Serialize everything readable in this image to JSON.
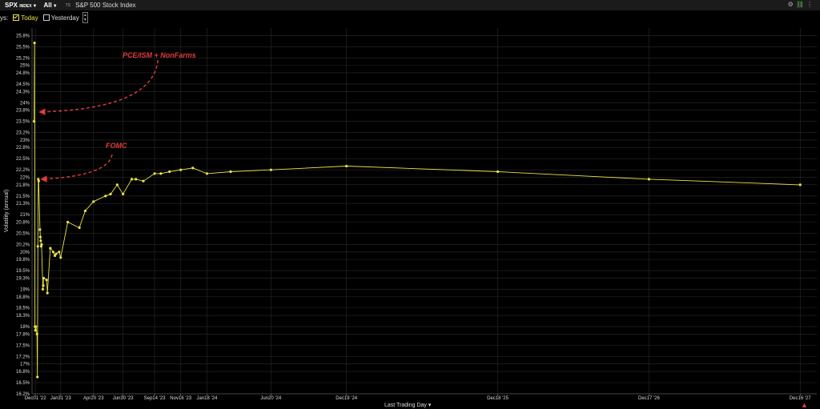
{
  "header": {
    "symbol": "SPX",
    "symbol_suffix": "INDEX",
    "range_selector": "All",
    "ts_label": "TS",
    "instrument_name": "S&P 500 Stock Index"
  },
  "days": {
    "prefix": "ys:",
    "today_label": "Today",
    "today_checked": true,
    "yesterday_label": "Yesterday",
    "yesterday_checked": false
  },
  "x_axis_menu": "Last Trading Day",
  "colors": {
    "series": "#e9e34a",
    "annotation": "#e23b3b",
    "grid": "#2a2a2a",
    "background": "#000000"
  },
  "chart_data": {
    "type": "line",
    "ylabel": "Volatility (annual)",
    "xlabel": "Last Trading Day",
    "x_scale": "time",
    "xlim": [
      "2022-11-23",
      "2028-01-25"
    ],
    "ylim": [
      16.2,
      26.0
    ],
    "y_ticks": [
      16.2,
      16.5,
      16.8,
      17,
      17.2,
      17.5,
      17.8,
      18,
      18.3,
      18.5,
      18.8,
      19,
      19.3,
      19.5,
      19.8,
      20,
      20.2,
      20.5,
      20.8,
      21,
      21.3,
      21.5,
      21.8,
      22,
      22.2,
      22.5,
      22.8,
      23,
      23.2,
      23.5,
      23.8,
      24,
      24.3,
      24.5,
      24.8,
      25,
      25.2,
      25.5,
      25.8
    ],
    "y_tick_labels": [
      "16.2%",
      "16.5%",
      "16.8%",
      "17%",
      "17.2%",
      "17.5%",
      "17.8%",
      "18%",
      "18.3%",
      "18.5%",
      "18.8%",
      "19%",
      "19.3%",
      "19.5%",
      "19.8%",
      "20%",
      "20.2%",
      "20.5%",
      "20.8%",
      "21%",
      "21.3%",
      "21.5%",
      "21.8%",
      "22%",
      "22.2%",
      "22.5%",
      "22.8%",
      "23%",
      "23.2%",
      "23.5%",
      "23.8%",
      "24%",
      "24.3%",
      "24.5%",
      "24.8%",
      "25%",
      "25.2%",
      "25.5%",
      "25.8%"
    ],
    "x_ticks": [
      {
        "date": "2022-12-01",
        "label": "Dec01 '22"
      },
      {
        "date": "2023-01-31",
        "label": "Jan31 '23"
      },
      {
        "date": "2023-04-20",
        "label": "Apr20 '23"
      },
      {
        "date": "2023-06-30",
        "label": "Jun30 '23"
      },
      {
        "date": "2023-09-14",
        "label": "Sep14 '23"
      },
      {
        "date": "2023-11-16",
        "label": "Nov16 '23"
      },
      {
        "date": "2024-01-18",
        "label": "Jan18 '24"
      },
      {
        "date": "2024-06-20",
        "label": "Jun20 '24"
      },
      {
        "date": "2024-12-19",
        "label": "Dec19 '24"
      },
      {
        "date": "2025-12-18",
        "label": "Dec18 '25"
      },
      {
        "date": "2026-12-17",
        "label": "Dec17 '26"
      },
      {
        "date": "2027-12-16",
        "label": "Dec16 '27"
      }
    ],
    "grid": true,
    "series": [
      {
        "points": [
          {
            "x": "2022-11-28",
            "y": 23.5
          },
          {
            "x": "2022-11-29",
            "y": 25.6
          },
          {
            "x": "2022-11-30",
            "y": 18.0
          },
          {
            "x": "2022-12-01",
            "y": 17.9
          },
          {
            "x": "2022-12-02",
            "y": 18.0
          },
          {
            "x": "2022-12-05",
            "y": 17.8
          },
          {
            "x": "2022-12-06",
            "y": 16.65
          },
          {
            "x": "2022-12-07",
            "y": 20.15
          },
          {
            "x": "2022-12-08",
            "y": 21.95
          },
          {
            "x": "2022-12-09",
            "y": 21.9
          },
          {
            "x": "2022-12-12",
            "y": 20.6
          },
          {
            "x": "2022-12-13",
            "y": 20.4
          },
          {
            "x": "2022-12-14",
            "y": 20.3
          },
          {
            "x": "2022-12-15",
            "y": 20.15
          },
          {
            "x": "2022-12-16",
            "y": 20.2
          },
          {
            "x": "2022-12-19",
            "y": 19.0
          },
          {
            "x": "2022-12-20",
            "y": 19.1
          },
          {
            "x": "2022-12-21",
            "y": 19.3
          },
          {
            "x": "2022-12-28",
            "y": 19.25
          },
          {
            "x": "2022-12-30",
            "y": 18.9
          },
          {
            "x": "2023-01-06",
            "y": 20.1
          },
          {
            "x": "2023-01-13",
            "y": 20.0
          },
          {
            "x": "2023-01-17",
            "y": 19.9
          },
          {
            "x": "2023-01-20",
            "y": 19.95
          },
          {
            "x": "2023-01-27",
            "y": 20.0
          },
          {
            "x": "2023-01-31",
            "y": 19.85
          },
          {
            "x": "2023-02-17",
            "y": 20.8
          },
          {
            "x": "2023-03-17",
            "y": 20.65
          },
          {
            "x": "2023-03-31",
            "y": 21.1
          },
          {
            "x": "2023-04-20",
            "y": 21.35
          },
          {
            "x": "2023-05-19",
            "y": 21.5
          },
          {
            "x": "2023-05-31",
            "y": 21.55
          },
          {
            "x": "2023-06-16",
            "y": 21.8
          },
          {
            "x": "2023-06-30",
            "y": 21.55
          },
          {
            "x": "2023-07-21",
            "y": 21.95
          },
          {
            "x": "2023-07-31",
            "y": 21.95
          },
          {
            "x": "2023-08-18",
            "y": 21.9
          },
          {
            "x": "2023-09-14",
            "y": 22.1
          },
          {
            "x": "2023-09-29",
            "y": 22.1
          },
          {
            "x": "2023-10-20",
            "y": 22.15
          },
          {
            "x": "2023-11-16",
            "y": 22.2
          },
          {
            "x": "2023-12-15",
            "y": 22.25
          },
          {
            "x": "2024-01-18",
            "y": 22.1
          },
          {
            "x": "2024-03-15",
            "y": 22.15
          },
          {
            "x": "2024-06-20",
            "y": 22.2
          },
          {
            "x": "2024-12-19",
            "y": 22.3
          },
          {
            "x": "2025-12-18",
            "y": 22.15
          },
          {
            "x": "2026-12-17",
            "y": 21.95
          },
          {
            "x": "2027-12-16",
            "y": 21.8
          }
        ]
      }
    ],
    "annotations": [
      {
        "text": "PCE/ISM + NonFarms",
        "points_to": {
          "x": "2022-12-12",
          "y": 23.75
        }
      },
      {
        "text": "FOMC",
        "points_to": {
          "x": "2022-12-16",
          "y": 21.95
        }
      }
    ]
  }
}
